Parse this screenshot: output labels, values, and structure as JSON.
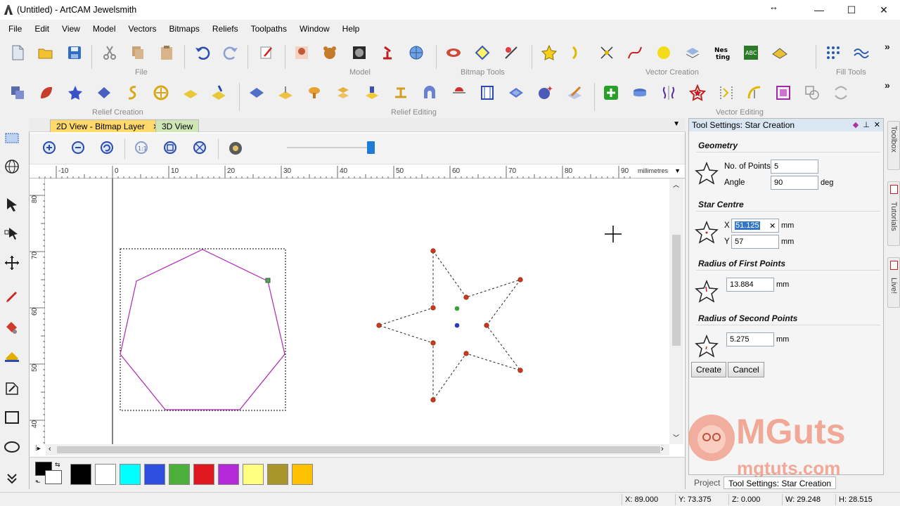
{
  "window": {
    "title": "(Untitled) - ArtCAM Jewelsmith",
    "minimize": "—",
    "maximize": "☐",
    "close": "✕",
    "resize_glyph": "↔"
  },
  "menu": [
    "File",
    "Edit",
    "View",
    "Model",
    "Vectors",
    "Bitmaps",
    "Reliefs",
    "Toolpaths",
    "Window",
    "Help"
  ],
  "toolbar_groups": {
    "file": "File",
    "model": "Model",
    "bitmap_tools": "Bitmap Tools",
    "vector_creation": "Vector Creation",
    "fill_tools": "Fill Tools",
    "relief_creation": "Relief Creation",
    "relief_editing": "Relief Editing",
    "vector_editing": "Vector Editing",
    "overflow": "»"
  },
  "tabs": {
    "active": "2D View - Bitmap Layer",
    "inactive": "3D View",
    "close": "✕",
    "dropdown": "▼"
  },
  "ruler": {
    "units": "millimetres",
    "h_labels": [
      "-10",
      "0",
      "10",
      "20",
      "30",
      "40",
      "50",
      "60",
      "70",
      "80",
      "90"
    ],
    "v_labels": [
      "80",
      "70",
      "60",
      "50",
      "40"
    ]
  },
  "colors": {
    "accent": "#1e7bd6",
    "polygon": "#b026b5",
    "star_outline": "#222222",
    "node": "#cc3a1c",
    "swatches": [
      "#000000",
      "#ffffff",
      "#00ffff",
      "#2e4fe0",
      "#4caf3c",
      "#e01820",
      "#b428d8",
      "#ffff80",
      "#a8962a",
      "#ffc000"
    ]
  },
  "tool_settings": {
    "header": "Tool Settings: Star Creation",
    "geometry_title": "Geometry",
    "points_label": "No. of Points",
    "points_value": "5",
    "angle_label": "Angle",
    "angle_value": "90",
    "angle_unit": "deg",
    "centre_title": "Star Centre",
    "x_label": "X",
    "x_value": "51.125",
    "y_label": "Y",
    "y_value": "57",
    "mm": "mm",
    "first_title": "Radius of First Points",
    "first_value": "13.884",
    "second_title": "Radius of Second Points",
    "second_value": "5.275",
    "create": "Create",
    "cancel": "Cancel",
    "clear": "✕"
  },
  "panel_tabs": {
    "project": "Project",
    "tool_settings": "Tool Settings: Star Creation"
  },
  "dock_tabs": [
    "Toolbox",
    "Tutorials",
    "Live!"
  ],
  "watermark": {
    "brand": "MGuts",
    "url": "mgtuts.com"
  },
  "status": {
    "x": "X: 89.000",
    "y": "Y: 73.375",
    "z": "Z: 0.000",
    "w": "W: 29.248",
    "h": "H: 28.515"
  }
}
